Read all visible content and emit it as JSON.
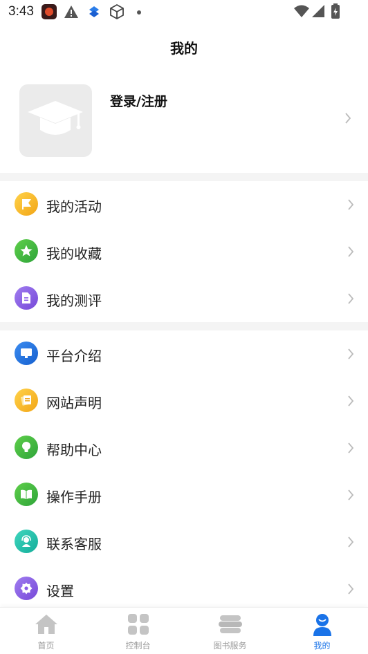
{
  "status_bar": {
    "time": "3:43",
    "icons": [
      "app-icon",
      "warning-icon",
      "dropbox-icon",
      "cube-icon",
      "dot-icon",
      "wifi-icon",
      "signal-icon",
      "battery-icon"
    ]
  },
  "header": {
    "title": "我的"
  },
  "profile": {
    "login_label": "登录/注册",
    "avatar_icon": "graduation-cap-icon"
  },
  "menu_group_1": [
    {
      "label": "我的活动",
      "icon": "flag-icon",
      "color": "#f5b82e"
    },
    {
      "label": "我的收藏",
      "icon": "star-icon",
      "color": "#3bb54a"
    },
    {
      "label": "我的测评",
      "icon": "document-icon",
      "color": "#8a5ce6"
    }
  ],
  "menu_group_2": [
    {
      "label": "平台介绍",
      "icon": "monitor-icon",
      "color": "#1a73e8"
    },
    {
      "label": "网站声明",
      "icon": "notes-icon",
      "color": "#f5b82e"
    },
    {
      "label": "帮助中心",
      "icon": "lightbulb-icon",
      "color": "#3bb54a"
    },
    {
      "label": "操作手册",
      "icon": "book-icon",
      "color": "#3bb54a"
    },
    {
      "label": "联系客服",
      "icon": "support-agent-icon",
      "color": "#1fbfa7"
    },
    {
      "label": "设置",
      "icon": "gear-icon",
      "color": "#8a5ce6"
    }
  ],
  "tab_bar": {
    "tabs": [
      {
        "label": "首页",
        "icon": "home-icon"
      },
      {
        "label": "控制台",
        "icon": "grid-icon"
      },
      {
        "label": "图书服务",
        "icon": "books-icon"
      },
      {
        "label": "我的",
        "icon": "person-icon",
        "active": true
      }
    ],
    "active_color": "#1a73e8"
  }
}
